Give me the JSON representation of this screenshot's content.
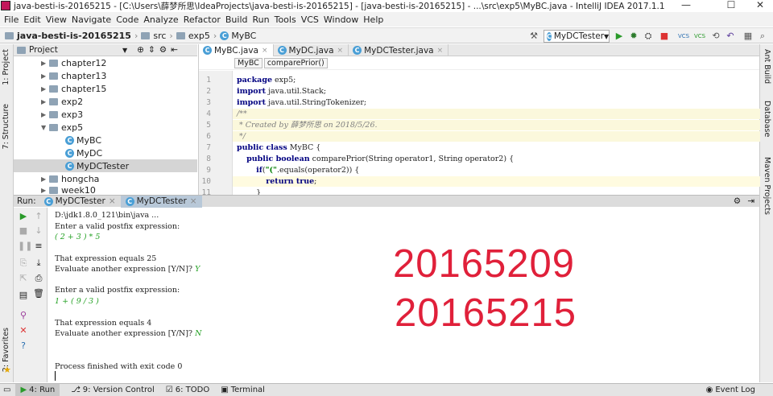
{
  "window": {
    "title": "java-besti-is-20165215 - [C:\\Users\\薛梦所思\\IdeaProjects\\java-besti-is-20165215] - [java-besti-is-20165215] - ...\\src\\exp5\\MyBC.java - IntelliJ IDEA 2017.1.1",
    "minimize": "—",
    "maximize": "☐",
    "close": "✕"
  },
  "menu": [
    "File",
    "Edit",
    "View",
    "Navigate",
    "Code",
    "Analyze",
    "Refactor",
    "Build",
    "Run",
    "Tools",
    "VCS",
    "Window",
    "Help"
  ],
  "breadcrumb": {
    "project": "java-besti-is-20165215",
    "src": "src",
    "pkg": "exp5",
    "cls": "MyBC"
  },
  "toolbar": {
    "run_config": "MyDCTester"
  },
  "project_panel": {
    "header": "Project",
    "items": [
      {
        "label": "chapter12",
        "kind": "folder"
      },
      {
        "label": "chapter13",
        "kind": "folder"
      },
      {
        "label": "chapter15",
        "kind": "folder"
      },
      {
        "label": "exp2",
        "kind": "folder"
      },
      {
        "label": "exp3",
        "kind": "folder"
      },
      {
        "label": "exp5",
        "kind": "folder"
      },
      {
        "label": "MyBC",
        "kind": "class"
      },
      {
        "label": "MyDC",
        "kind": "class"
      },
      {
        "label": "MyDCTester",
        "kind": "class"
      },
      {
        "label": "hongcha",
        "kind": "folder"
      },
      {
        "label": "week10",
        "kind": "folder"
      }
    ]
  },
  "side_tabs": {
    "left": [
      "1: Project",
      "7: Structure",
      "2: Favorites"
    ],
    "right": [
      "Ant Build",
      "Database",
      "Maven Projects"
    ]
  },
  "editor": {
    "tabs": [
      "MyBC.java",
      "MyDC.java",
      "MyDCTester.java"
    ],
    "crumb_class": "MyBC",
    "crumb_method": "comparePrior()",
    "line_numbers": [
      "1",
      "2",
      "3",
      "4",
      "5",
      "6",
      "7",
      "8",
      "9",
      "10",
      "11"
    ],
    "lines": [
      "package exp5;",
      "import java.util.Stack;",
      "import java.util.StringTokenizer;",
      "/**",
      " * Created by 薛梦所思 on 2018/5/26.",
      " */",
      "public class MyBC {",
      "    public boolean comparePrior(String operator1, String operator2) {",
      "        if(\"(\".equals(operator2)) {",
      "            return true;",
      "        }"
    ]
  },
  "run_panel": {
    "label": "Run:",
    "tabs": [
      "MyDCTester",
      "MyDCTester"
    ],
    "console": {
      "cmd": "D:\\jdk1.8.0_121\\bin\\java ...",
      "prompt1": "Enter a valid postfix expression:",
      "input1": "( 2 + 3 ) * 5",
      "result1": "That expression equals 25",
      "again1": "Evaluate another expression [Y/N]? ",
      "answer1": "Y",
      "prompt2": "Enter a valid postfix expression:",
      "input2": "1 + ( 9 / 3 )",
      "result2": "That expression equals 4",
      "again2": "Evaluate another expression [Y/N]? ",
      "answer2": "N",
      "finished": "Process finished with exit code 0"
    }
  },
  "watermark": {
    "line1": "20165209",
    "line2": "20165215"
  },
  "statusbar": {
    "run": "4: Run",
    "vcs": "9: Version Control",
    "todo": "6: TODO",
    "terminal": "Terminal",
    "event_log": "Event Log"
  }
}
